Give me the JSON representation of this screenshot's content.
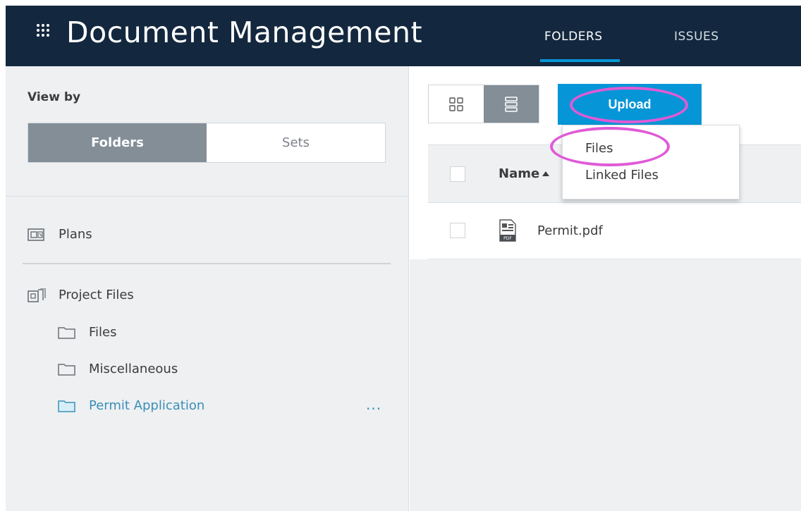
{
  "header": {
    "app_title": "Document Management",
    "tabs": [
      {
        "label": "FOLDERS",
        "active": true
      },
      {
        "label": "ISSUES",
        "active": false
      }
    ]
  },
  "sidebar": {
    "view_by_label": "View by",
    "view_options": [
      {
        "label": "Folders",
        "active": true
      },
      {
        "label": "Sets",
        "active": false
      }
    ],
    "items": [
      {
        "label": "Plans",
        "icon": "plans-icon"
      },
      {
        "label": "Project Files",
        "icon": "project-files-icon"
      },
      {
        "label": "Files",
        "icon": "folder-icon"
      },
      {
        "label": "Miscellaneous",
        "icon": "folder-icon"
      },
      {
        "label": "Permit Application",
        "icon": "folder-icon",
        "selected": true
      }
    ],
    "more_label": "..."
  },
  "toolbar": {
    "view_modes": [
      "grid-view-icon",
      "list-view-icon"
    ],
    "active_view": "list-view-icon",
    "upload_label": "Upload",
    "upload_menu": [
      "Files",
      "Linked Files"
    ]
  },
  "table": {
    "columns": [
      "Name"
    ],
    "sort": "ascending",
    "rows": [
      {
        "name": "Permit.pdf",
        "type": "pdf"
      }
    ]
  },
  "colors": {
    "header_bg": "#13283e",
    "accent": "#0696d7",
    "highlight_ring": "#e05ad6",
    "selected_folder": "#3a8fb7"
  }
}
